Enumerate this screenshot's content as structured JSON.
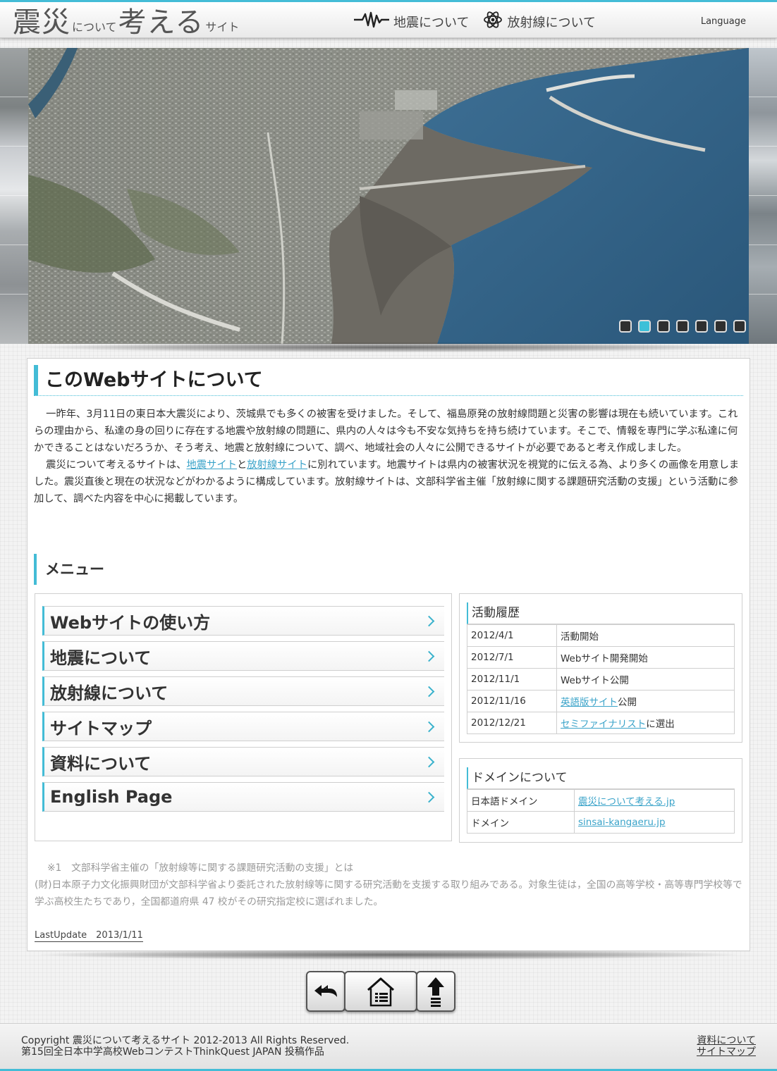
{
  "header": {
    "logo": {
      "part1": "震災",
      "part2": "について",
      "part3": "考える",
      "part4": "サイト"
    },
    "nav": [
      {
        "label": "地震について",
        "icon": "seismograph-icon"
      },
      {
        "label": "放射線について",
        "icon": "atom-icon"
      }
    ],
    "language_label": "Language"
  },
  "slideshow": {
    "slide_count": 7,
    "active_index": 1
  },
  "about": {
    "title": "このWebサイトについて",
    "para1": "一昨年、3月11日の東日本大震災により、茨城県でも多くの被害を受けました。そして、福島原発の放射線問題と災害の影響は現在も続いています。これらの理由から、私達の身の回りに存在する地震や放射線の問題に、県内の人々は今も不安な気持ちを持ち続けています。そこで、情報を専門に学ぶ私達に何かできることはないだろうか、そう考え、地震と放射線について、調べ、地域社会の人々に公開できるサイトが必要であると考え作成しました。",
    "para2_prefix": "震災について考えるサイトは、",
    "link_earthquake": "地震サイト",
    "para2_and": "と",
    "link_radiation": "放射線サイト",
    "para2_suffix": "に別れています。地震サイトは県内の被害状況を視覚的に伝える為、より多くの画像を用意しました。震災直後と現在の状況などがわかるように構成しています。放射線サイトは、文部科学省主催「放射線に関する課題研究活動の支援」という活動に参加して、調べた内容を中心に掲載しています。"
  },
  "menu": {
    "title": "メニュー",
    "items": [
      {
        "label": "Webサイトの使い方"
      },
      {
        "label": "地震について"
      },
      {
        "label": "放射線について"
      },
      {
        "label": "サイトマップ"
      },
      {
        "label": "資料について"
      },
      {
        "label": "English Page"
      }
    ]
  },
  "history": {
    "title": "活動履歴",
    "rows": [
      {
        "date": "2012/4/1",
        "text": "活動開始",
        "link": "",
        "suffix": ""
      },
      {
        "date": "2012/7/1",
        "text": "Webサイト開発開始",
        "link": "",
        "suffix": ""
      },
      {
        "date": "2012/11/1",
        "text": "Webサイト公開",
        "link": "",
        "suffix": ""
      },
      {
        "date": "2012/11/16",
        "text": "",
        "link": "英語版サイト",
        "suffix": "公開"
      },
      {
        "date": "2012/12/21",
        "text": "",
        "link": "セミファイナリスト",
        "suffix": "に選出"
      }
    ]
  },
  "domain": {
    "title": "ドメインについて",
    "rows": [
      {
        "label": "日本語ドメイン",
        "value": "震災について考える.jp"
      },
      {
        "label": "ドメイン",
        "value": "sinsai-kangaeru.jp"
      }
    ]
  },
  "note": {
    "line1": "※1　文部科学省主催の「放射線等に関する課題研究活動の支援」とは",
    "line2": "(財)日本原子力文化振興財団が文部科学省より委託された放射線等に関する研究活動を支援する取り組みである。対象生徒は，全国の高等学校・高等専門学校等で学ぶ高校生たちであり，全国都道府県 47 校がその研究指定校に選ばれました。"
  },
  "last_update": "LastUpdate　2013/1/11",
  "bottom_buttons": [
    {
      "icon": "back-arrow-icon"
    },
    {
      "icon": "home-icon"
    },
    {
      "icon": "up-arrow-icon"
    }
  ],
  "footer": {
    "copyright": "Copyright 震災について考えるサイト 2012-2013 All Rights Reserved.",
    "contest": "第15回全日本中学高校WebコンテストThinkQuest JAPAN 投稿作品",
    "links": [
      "資料について",
      "サイトマップ"
    ]
  },
  "colors": {
    "accent": "#43bcd6",
    "link": "#3aa3c9"
  }
}
